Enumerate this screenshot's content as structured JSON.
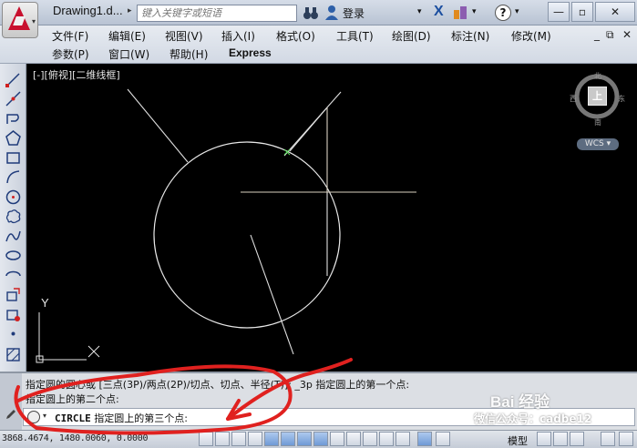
{
  "titlebar": {
    "doc_title": "Drawing1.d...",
    "search_placeholder": "键入关键字或短语",
    "login_label": "登录",
    "x_icon": "X",
    "help_icon": "?",
    "window_controls": {
      "minimize": "—",
      "restore": "▫",
      "close": "✕"
    }
  },
  "menu": {
    "row1": [
      "文件(F)",
      "编辑(E)",
      "视图(V)",
      "插入(I)",
      "格式(O)",
      "工具(T)",
      "绘图(D)",
      "标注(N)",
      "修改(M)"
    ],
    "row2": [
      "参数(P)",
      "窗口(W)",
      "帮助(H)",
      "Express"
    ],
    "mdi_controls": {
      "minimize": "_",
      "restore": "⧉",
      "close": "✕"
    }
  },
  "toolbar": {
    "tools": [
      "line-icon",
      "construction-line-icon",
      "polyline-icon",
      "polygon-icon",
      "rectangle-icon",
      "arc-icon",
      "circle-icon",
      "revision-cloud-icon",
      "spline-icon",
      "ellipse-icon",
      "ellipse-arc-icon",
      "insert-block-icon",
      "make-block-icon",
      "point-icon",
      "hatch-icon"
    ]
  },
  "viewport": {
    "view_label": "[-][俯视][二维线框]",
    "viewcube": {
      "north": "北",
      "south": "南",
      "east": "东",
      "west": "西",
      "top_face": "上",
      "wcs": "WCS ▾"
    },
    "ucs_y_label": "Y"
  },
  "command": {
    "history": [
      "指定圆的圆心或 [三点(3P)/两点(2P)/切点、切点、半径(T)]: _3p 指定圆上的第一个点:",
      "指定圆上的第二个点:"
    ],
    "current_command": "CIRCLE",
    "current_prompt": "指定圆上的第三个点:"
  },
  "status": {
    "coords": "3868.4674, 1480.0060, 0.0000",
    "model_label": "模型"
  },
  "watermark": {
    "main": "Bai 经验",
    "sub": "微信公众号：cadbe12"
  },
  "colors": {
    "canvas": "#000000",
    "drawing_line": "#ffffff",
    "annotation": "#e0211f"
  }
}
